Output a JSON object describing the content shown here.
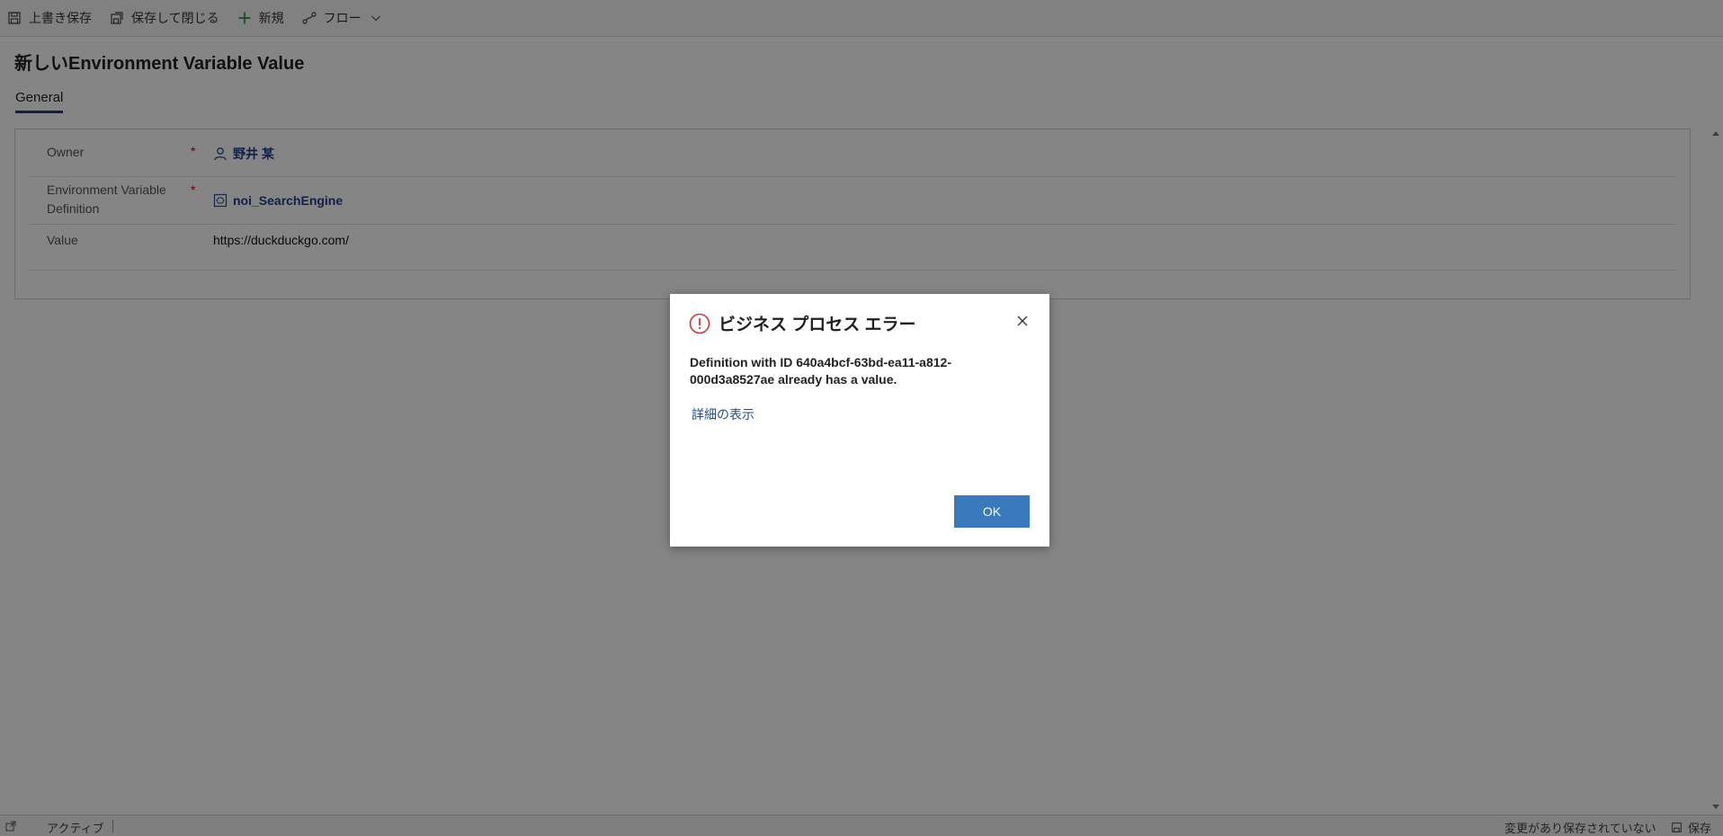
{
  "toolbar": {
    "save_label": "上書き保存",
    "save_close_label": "保存して閉じる",
    "new_label": "新規",
    "flow_label": "フロー"
  },
  "page": {
    "title": "新しいEnvironment Variable Value",
    "tab_general": "General"
  },
  "form": {
    "owner_label": "Owner",
    "owner_value": "野井 某",
    "definition_label_line1": "Environment Variable",
    "definition_label_line2": "Definition",
    "definition_value": "noi_SearchEngine",
    "value_label": "Value",
    "value_value": "https://duckduckgo.com/",
    "required_marker": "*"
  },
  "statusbar": {
    "state": "アクティブ",
    "unsaved": "変更があり保存されていない",
    "save": "保存"
  },
  "dialog": {
    "title": "ビジネス プロセス エラー",
    "message": "Definition with ID 640a4bcf-63bd-ea11-a812-000d3a8527ae already has a value.",
    "details_link": "詳細の表示",
    "ok_label": "OK"
  },
  "colors": {
    "accent": "#3b79bd",
    "link": "#1f3f8f",
    "error": "#d13438",
    "required": "#cc0000"
  },
  "icons": [
    "save-icon",
    "save-close-icon",
    "plus-icon",
    "flow-icon",
    "chevron-down-icon",
    "person-icon",
    "entity-icon",
    "error-icon",
    "close-icon",
    "popout-icon"
  ]
}
